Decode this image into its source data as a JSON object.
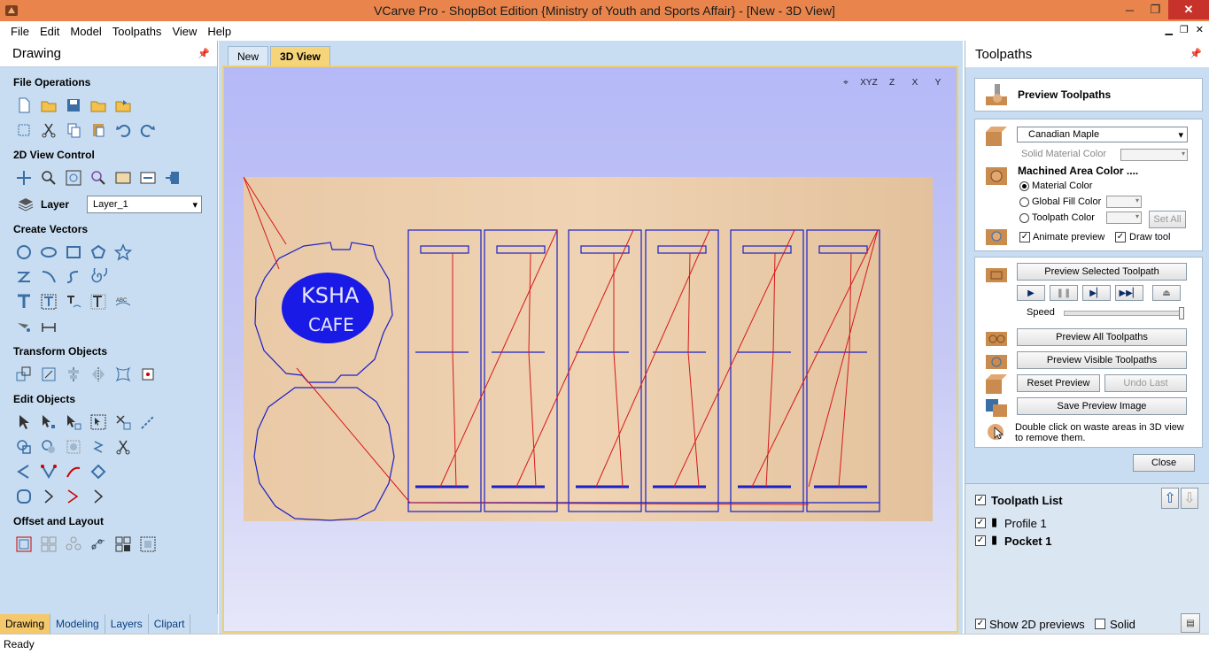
{
  "window": {
    "title": "VCarve Pro - ShopBot Edition {Ministry of Youth and Sports Affair} - [New - 3D View]",
    "minimize": "─",
    "maximize": "❐",
    "close": "✕"
  },
  "menu": [
    "File",
    "Edit",
    "Model",
    "Toolpaths",
    "View",
    "Help"
  ],
  "left_panel": {
    "title": "Drawing",
    "sections": {
      "file_ops": "File Operations",
      "view_control": "2D View Control",
      "layer_label": "Layer",
      "layer_value": "Layer_1",
      "create_vectors": "Create Vectors",
      "transform": "Transform Objects",
      "edit": "Edit Objects",
      "offset": "Offset and Layout"
    },
    "tabs": [
      "Drawing",
      "Modeling",
      "Layers",
      "Clipart"
    ]
  },
  "center": {
    "tabs": [
      "New",
      "3D View"
    ],
    "view_icons": [
      "⌖",
      "XYZ",
      "Z",
      "X",
      "Y"
    ],
    "logo_line1": "KSHA",
    "logo_line2": "CAFE"
  },
  "right_panel": {
    "title": "Toolpaths",
    "preview_title": "Preview Toolpaths",
    "material": "Canadian Maple",
    "solid_material_color": "Solid Material Color",
    "machined_area_color": "Machined Area Color ....",
    "radio_material": "Material Color",
    "radio_global": "Global Fill Color",
    "radio_toolpath": "Toolpath Color",
    "set_all": "Set All",
    "animate_preview": "Animate preview",
    "draw_tool": "Draw tool",
    "preview_selected": "Preview Selected Toolpath",
    "speed": "Speed",
    "preview_all": "Preview All Toolpaths",
    "preview_visible": "Preview Visible Toolpaths",
    "reset_preview": "Reset Preview",
    "undo_last": "Undo Last",
    "save_preview_image": "Save Preview Image",
    "hint": "Double click on waste areas in 3D view to remove them.",
    "close": "Close",
    "toolpath_list_title": "Toolpath List",
    "toolpaths": [
      "Profile 1",
      "Pocket 1"
    ],
    "show_2d_previews": "Show 2D previews",
    "solid": "Solid"
  },
  "status": "Ready"
}
